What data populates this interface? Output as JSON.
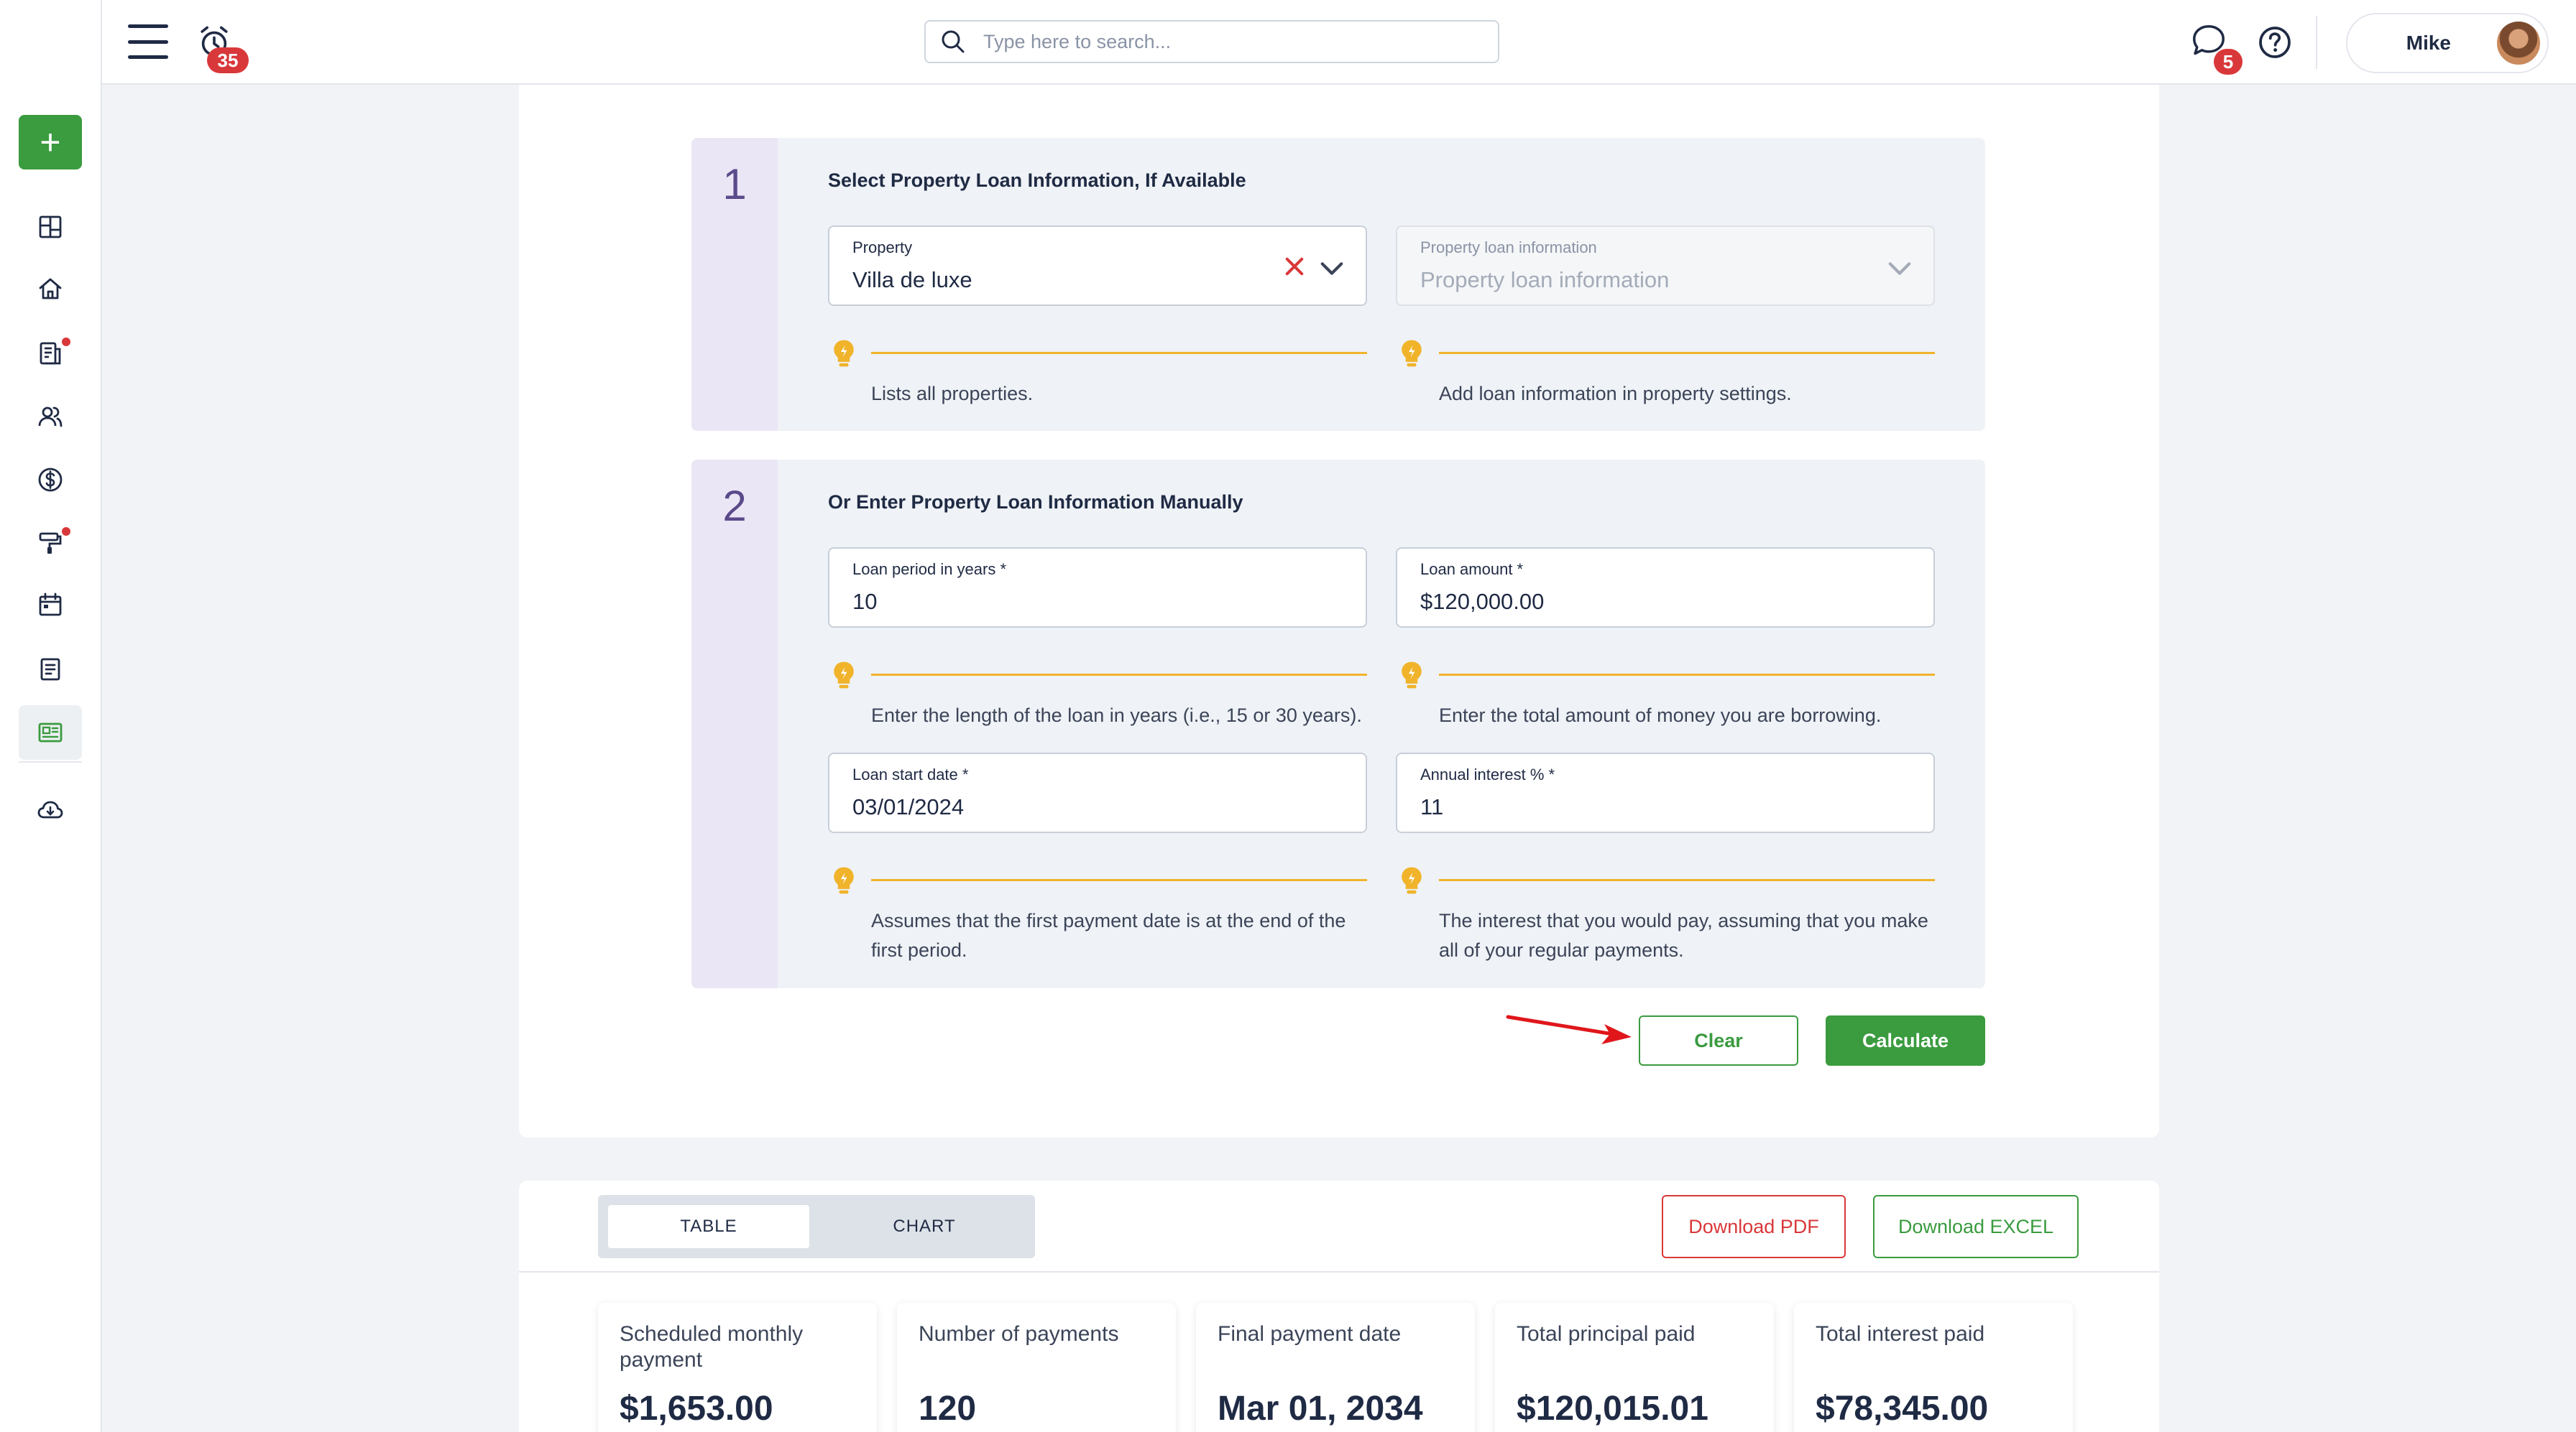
{
  "header": {
    "notifications_count": "35",
    "search_placeholder": "Type here to search...",
    "messages_count": "5",
    "user_name": "Mike"
  },
  "sidebar": {
    "add_label": "+",
    "items": [
      "dashboard-icon",
      "home-icon",
      "reports-icon",
      "people-icon",
      "dollar-icon",
      "maintenance-icon",
      "calendar-icon",
      "document-icon",
      "calculator-icon",
      "cloud-download-icon"
    ]
  },
  "section1": {
    "number": "1",
    "title": "Select Property Loan Information, If Available",
    "property_label": "Property",
    "property_value": "Villa de luxe",
    "loan_info_label": "Property loan information",
    "loan_info_placeholder": "Property loan information",
    "hint_property": "Lists all properties.",
    "hint_loan_info": "Add loan information in property settings."
  },
  "section2": {
    "number": "2",
    "title": "Or Enter Property Loan Information Manually",
    "period_label": "Loan period in years *",
    "period_value": "10",
    "amount_label": "Loan amount *",
    "amount_value": "$120,000.00",
    "hint_period": "Enter the length of the loan in years (i.e., 15 or 30 years).",
    "hint_amount": "Enter the total amount of money you are borrowing.",
    "start_label": "Loan start date *",
    "start_value": "03/01/2024",
    "interest_label": "Annual interest % *",
    "interest_value": "11",
    "hint_start": "Assumes that the first payment date is at the end of the first period.",
    "hint_interest": "The interest that you would pay, assuming that you make all of your regular payments."
  },
  "actions": {
    "clear_label": "Clear",
    "calculate_label": "Calculate"
  },
  "results": {
    "tabs": [
      "TABLE",
      "CHART"
    ],
    "download_pdf": "Download PDF",
    "download_excel": "Download EXCEL",
    "stats": [
      {
        "label": "Scheduled monthly payment",
        "value": "$1,653.00"
      },
      {
        "label": "Number of payments",
        "value": "120"
      },
      {
        "label": "Final payment date",
        "value": "Mar 01, 2034"
      },
      {
        "label": "Total principal paid",
        "value": "$120,015.01"
      },
      {
        "label": "Total interest paid",
        "value": "$78,345.00"
      }
    ]
  },
  "colors": {
    "brand_green": "#3a9b3f",
    "alert_red": "#d9383a",
    "hint_yellow": "#f0b32a",
    "section_bg": "#eff2f6",
    "number_col_bg": "#ebe6f5"
  }
}
